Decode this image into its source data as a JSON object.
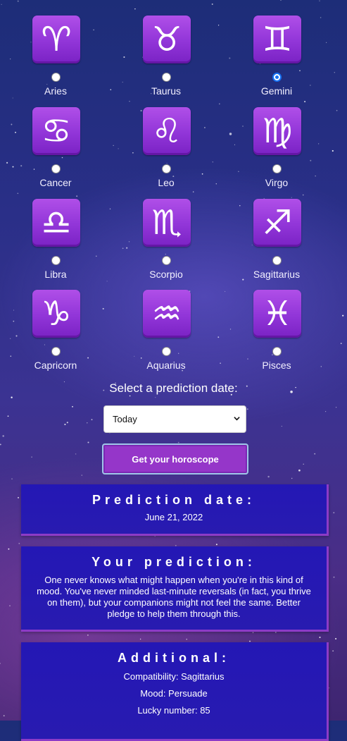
{
  "signs": [
    {
      "name": "Aries",
      "glyph": "♈",
      "checked": false
    },
    {
      "name": "Taurus",
      "glyph": "♉",
      "checked": false
    },
    {
      "name": "Gemini",
      "glyph": "♊",
      "checked": true
    },
    {
      "name": "Cancer",
      "glyph": "♋",
      "checked": false
    },
    {
      "name": "Leo",
      "glyph": "♌",
      "checked": false
    },
    {
      "name": "Virgo",
      "glyph": "♍",
      "checked": false
    },
    {
      "name": "Libra",
      "glyph": "♎",
      "checked": false
    },
    {
      "name": "Scorpio",
      "glyph": "♏",
      "checked": false
    },
    {
      "name": "Sagittarius",
      "glyph": "♐",
      "checked": false
    },
    {
      "name": "Capricorn",
      "glyph": "♑",
      "checked": false
    },
    {
      "name": "Aquarius",
      "glyph": "♒",
      "checked": false
    },
    {
      "name": "Pisces",
      "glyph": "♓",
      "checked": false
    }
  ],
  "date_picker": {
    "label": "Select a prediction date:",
    "selected": "Today"
  },
  "submit_label": "Get your horoscope",
  "prediction_date": {
    "title": "Prediction date:",
    "value": "June 21, 2022"
  },
  "prediction": {
    "title": "Your prediction:",
    "text": "One never knows what might happen when you're in this kind of mood. You've never minded last-minute reversals (in fact, you thrive on them), but your companions might not feel the same. Better pledge to help them through this."
  },
  "additional": {
    "title": "Additional:",
    "compatibility": "Compatibility: Sagittarius",
    "mood": "Mood: Persuade",
    "lucky_number": "Lucky number: 85"
  },
  "colors": {
    "tile": "#9135d8",
    "card": "#2417b5",
    "button": "#9536c9",
    "radio_checked": "#1672f5"
  }
}
